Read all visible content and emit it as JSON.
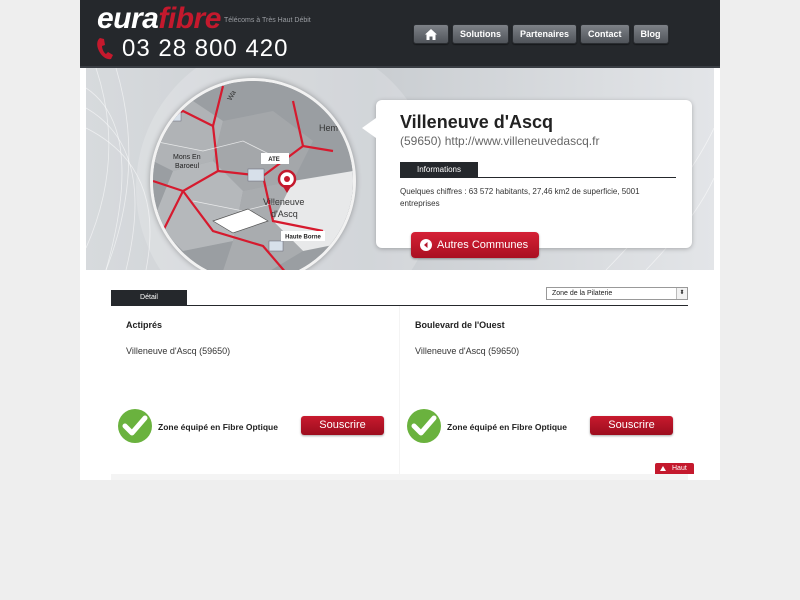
{
  "brand": {
    "logo_part1": "eura",
    "logo_part2": "fibre",
    "tagline": "Télécoms à Très Haut Débit",
    "phone": "03 28 800 420"
  },
  "nav": {
    "items": [
      {
        "label": "Solutions"
      },
      {
        "label": "Partenaires"
      },
      {
        "label": "Contact"
      },
      {
        "label": "Blog"
      }
    ]
  },
  "map": {
    "labels": {
      "place1": "Mons En",
      "place1b": "Baroeul",
      "ate": "ATE",
      "city1": "Villeneuve",
      "city2": "d'Ascq",
      "haute_borne": "Haute Borne",
      "hem": "Hem",
      "wasq": "Wa"
    }
  },
  "city": {
    "name": "Villeneuve d'Ascq",
    "postcode_url": "(59650) http://www.villeneuvedascq.fr",
    "info_tab": "Informations",
    "facts": "Quelques chiffres : 63 572 habitants, 27,46 km2 de superficie, 5001 entreprises",
    "autres_label": "Autres Communes"
  },
  "detail": {
    "tab": "Détail",
    "select_value": "Zone de la Pilaterie",
    "zones": [
      {
        "name": "Actiprés",
        "city": "Villeneuve d'Ascq (59650)",
        "status": "Zone équipé en Fibre Optique",
        "button": "Souscrire"
      },
      {
        "name": "Boulevard de l'Ouest",
        "city": "Villeneuve d'Ascq (59650)",
        "status": "Zone équipé en Fibre Optique",
        "button": "Souscrire"
      }
    ],
    "haut_label": "Haut"
  },
  "colors": {
    "brand_red": "#c4192d",
    "header_dark": "#25282c",
    "check_green": "#6ab23e"
  },
  "icons": [
    "home-icon",
    "phone-icon",
    "arrow-left-circle-icon",
    "check-circle-icon",
    "arrow-up-icon"
  ]
}
